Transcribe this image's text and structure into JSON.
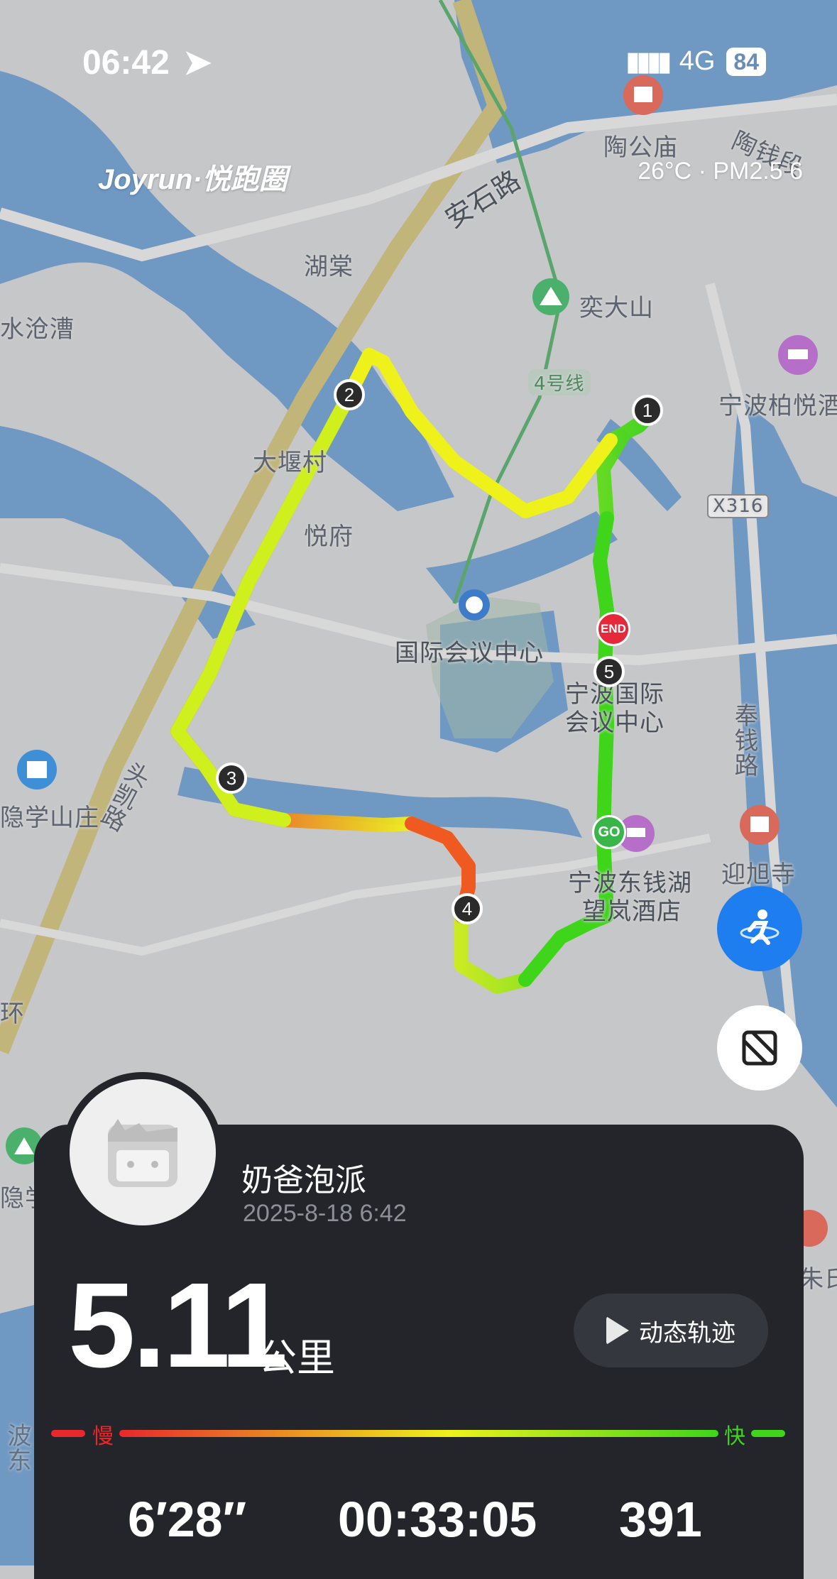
{
  "status_bar": {
    "time": "06:42",
    "network": "4G",
    "battery": "84"
  },
  "brand": "Joyrun·悦跑圈",
  "weather": "26°C · PM2.5 6",
  "map": {
    "labels": {
      "taogongmiao": "陶公庙",
      "taoqian": "陶钱段",
      "anshilu": "安石路",
      "hutang": "湖棠",
      "shuicangcao": "水沧漕",
      "yidashan": "奕大山",
      "line4": "4号线",
      "bolan": "宁波柏悦酒",
      "dayan": "大堰村",
      "yuefu": "悦府",
      "x316": "X316",
      "guoji": "国际会议中心",
      "ningbo_guoji_1": "宁波国际",
      "ningbo_guoji_2": "会议中心",
      "fengqianlu": "奉钱路",
      "touyaolu": "头凯路",
      "xueshan": "隐学山庄",
      "yingxusi": "迎旭寺",
      "hotel_1": "宁波东钱湖",
      "hotel_2": "望岚酒店",
      "huan": "环",
      "yinxue2": "隐学",
      "zhushi": "朱氏",
      "bodong": "波东"
    },
    "route_markers": [
      "1",
      "2",
      "3",
      "4",
      "5"
    ],
    "end_label": "END",
    "go_label": "GO"
  },
  "buttons": {
    "runner_icon": "runner-icon",
    "fit_icon": "fit-route-icon"
  },
  "run": {
    "user": "奶爸泡派",
    "datetime": "2025-8-18 6:42",
    "distance": "5.11",
    "distance_unit": "公里",
    "replay_label": "动态轨迹",
    "slow_label": "慢",
    "fast_label": "快",
    "pace": "6′28′′",
    "duration": "00:33:05",
    "calories": "391"
  },
  "colors": {
    "water": "#6f98c2",
    "land": "#c6c7c8",
    "card": "#23252a",
    "slow": "#e8282b",
    "fast": "#3ed51a",
    "route_mid": "#eef21a",
    "fab_blue": "#1e7ef0"
  }
}
